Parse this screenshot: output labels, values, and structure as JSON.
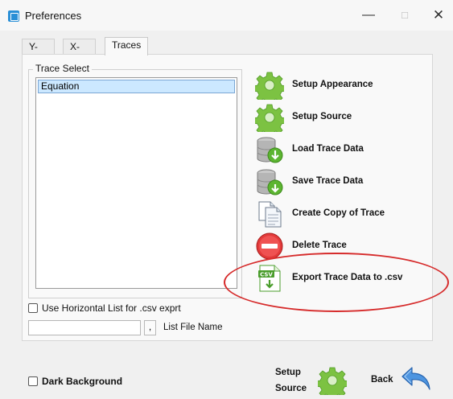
{
  "window": {
    "title": "Preferences",
    "minimize": "—",
    "maximize": "□",
    "close": "✕"
  },
  "tabs": [
    {
      "label": "Y-Axis"
    },
    {
      "label": "X-Axis"
    },
    {
      "label": "Traces",
      "active": true
    }
  ],
  "trace_select": {
    "legend": "Trace Select",
    "items": [
      "Equation"
    ],
    "selected": "Equation"
  },
  "actions": [
    {
      "label": "Setup Appearance",
      "icon": "gear-icon"
    },
    {
      "label": "Setup Source",
      "icon": "gear-icon"
    },
    {
      "label": "Load Trace Data",
      "icon": "database-load-icon"
    },
    {
      "label": "Save Trace Data",
      "icon": "database-save-icon"
    },
    {
      "label": "Create Copy of Trace",
      "icon": "copy-icon"
    },
    {
      "label": "Delete Trace",
      "icon": "delete-icon"
    },
    {
      "label": "Export Trace Data to .csv",
      "icon": "csv-export-icon"
    }
  ],
  "horizontal_list": {
    "label": "Use Horizontal List for .csv exprt",
    "checked": false
  },
  "file_name": {
    "value": "",
    "button": ",",
    "label": "List File Name"
  },
  "footer": {
    "dark_background": {
      "label": "Dark Background",
      "checked": false
    },
    "setup_source_line1": "Setup",
    "setup_source_line2": "Source",
    "back": "Back"
  },
  "colors": {
    "accent": "#2a8fd6",
    "highlight": "#d62b2b",
    "gear": "#7cc242"
  }
}
